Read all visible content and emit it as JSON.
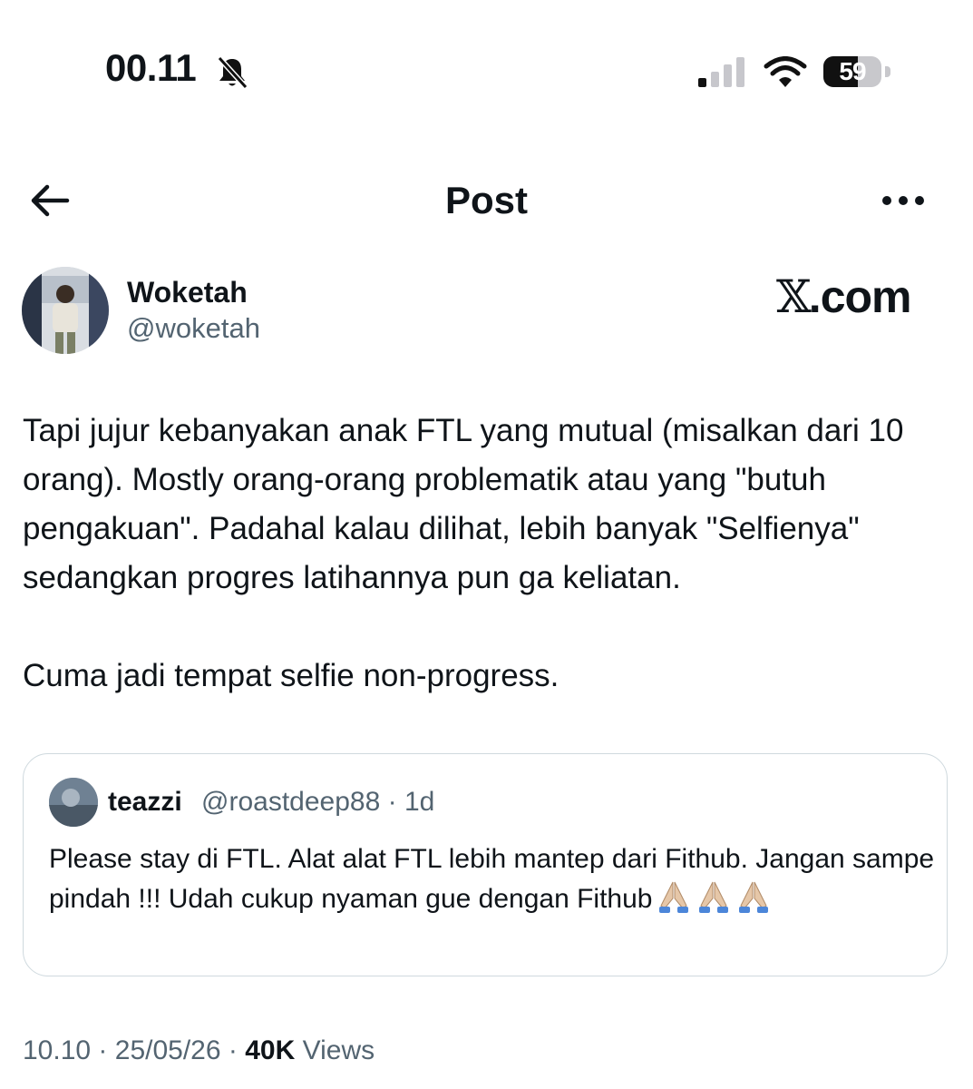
{
  "status_bar": {
    "time": "00.11",
    "battery_percent": "59",
    "battery_level": 0.59,
    "icons": [
      "bell-slash-icon",
      "cellular-signal-icon",
      "wifi-icon",
      "battery-icon"
    ]
  },
  "header": {
    "title": "Post",
    "back_icon": "arrow-left-icon",
    "more_icon": "more-horizontal-icon"
  },
  "author": {
    "name": "Woketah",
    "handle": "@woketah"
  },
  "brand": {
    "x_mark": "𝕏",
    "domain": ".com"
  },
  "post": {
    "paragraph1": "Tapi jujur kebanyakan anak FTL yang mutual (misalkan dari 10 orang). Mostly orang-orang problematik atau yang \"butuh pengakuan\". Padahal kalau dilihat, lebih banyak \"Selfienya\" sedangkan progres latihannya pun ga keliatan.",
    "paragraph2": "Cuma jadi tempat selfie non-progress."
  },
  "quote": {
    "name": "teazzi",
    "handle": "@roastdeep88",
    "separator": "·",
    "age": "1d",
    "text": "Please stay di FTL. Alat alat FTL lebih mantep dari Fithub. Jangan sampe pindah !!! Udah cukup nyaman gue dengan Fithub",
    "emoji_icon": "folded-hands-icon",
    "emoji_count": 3
  },
  "footer": {
    "time": "10.10",
    "sep1": "·",
    "date": "25/05/26",
    "sep2": "·",
    "views_count": "40K",
    "views_label": "Views"
  }
}
